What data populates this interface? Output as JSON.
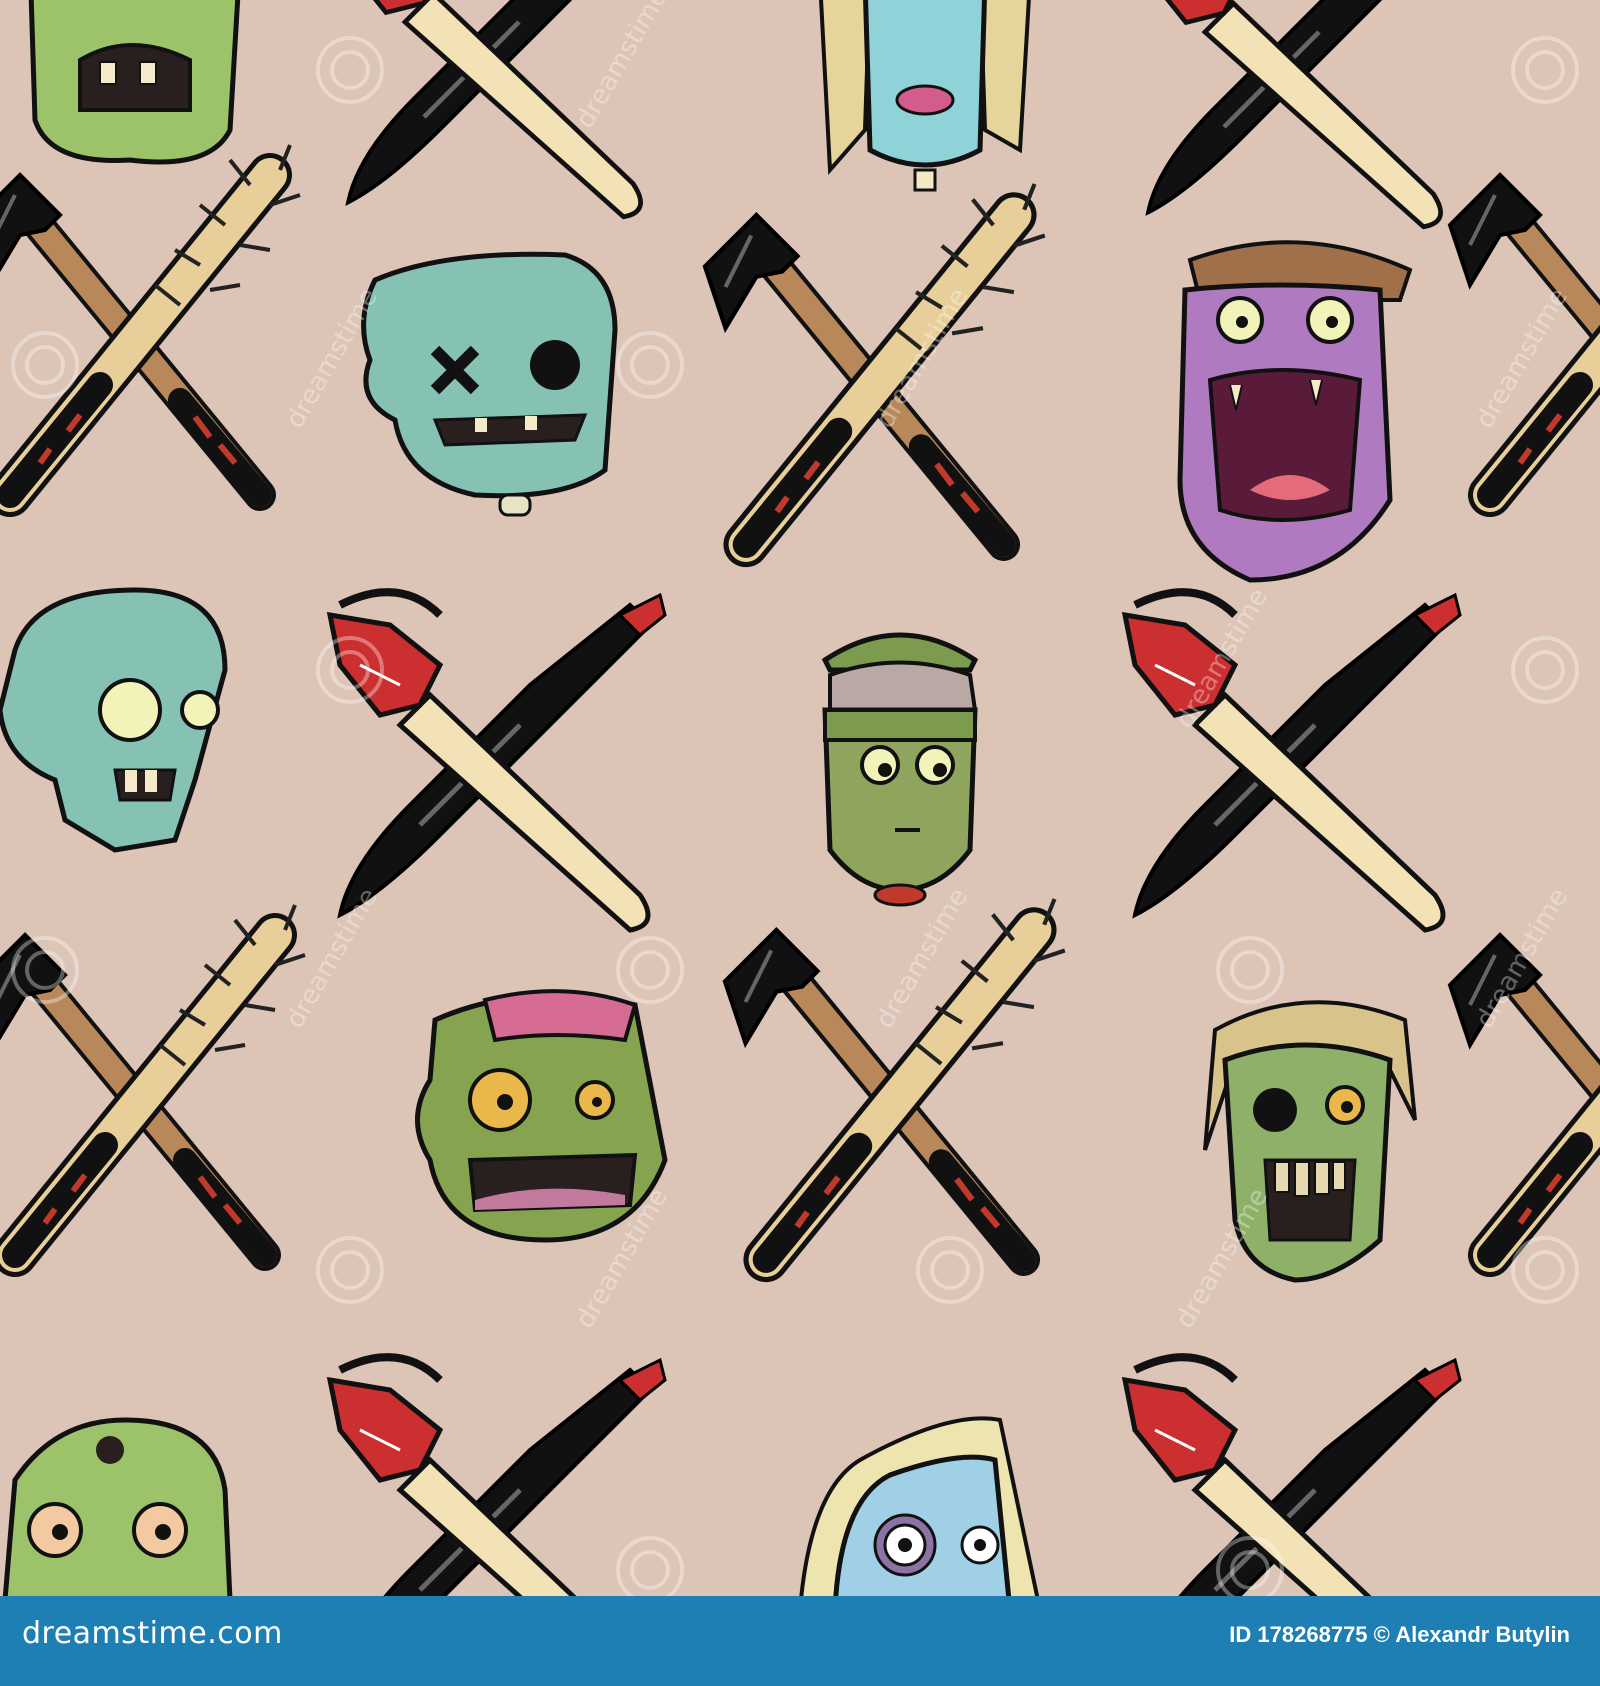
{
  "footer": {
    "brand": "dreamstime.com",
    "id_label": "ID",
    "id_value": "178268775",
    "copyright": "©",
    "author": "Alexandr Butylin"
  },
  "watermark": {
    "text": "dreamstime"
  },
  "pattern": {
    "background_color": "#dcc4b6",
    "items": [
      "zombie-head-green-gap-teeth",
      "crossed-knife-and-chainsaw-bar",
      "zombie-head-blonde-blue",
      "crossed-axe-and-nail-bat",
      "zombie-head-teal-x-eye",
      "zombie-head-purple-screaming",
      "zombie-head-teal-bulging-eyes",
      "crossed-chainsaw-and-machete",
      "zombie-head-exposed-brain",
      "zombie-head-green-stitched",
      "zombie-head-blonde-skull",
      "zombie-head-green-bald",
      "zombie-head-blonde-purple-eye"
    ]
  },
  "colors": {
    "footer_bar": "#1e7fb4",
    "zombie_green": "#9cc36a",
    "zombie_teal": "#86c2b4",
    "zombie_purple": "#b07ac0",
    "chainsaw_red": "#cc2f2f",
    "wood": "#e8cf9a",
    "handle": "#b8875a",
    "blade": "#111111"
  }
}
